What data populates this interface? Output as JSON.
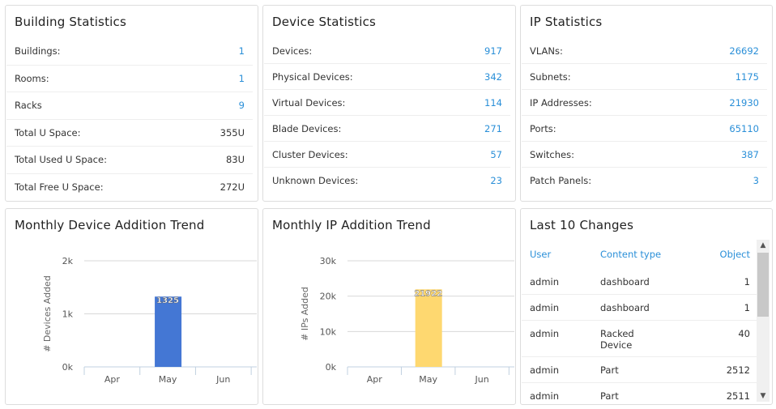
{
  "building": {
    "title": "Building Statistics",
    "rows": [
      {
        "label": "Buildings:",
        "value": "1",
        "link": true
      },
      {
        "label": "Rooms:",
        "value": "1",
        "link": true
      },
      {
        "label": "Racks",
        "value": "9",
        "link": true
      },
      {
        "label": "Total U Space:",
        "value": "355U",
        "link": false
      },
      {
        "label": "Total Used U Space:",
        "value": "83U",
        "link": false
      },
      {
        "label": "Total Free U Space:",
        "value": "272U",
        "link": false
      }
    ]
  },
  "device": {
    "title": "Device Statistics",
    "rows": [
      {
        "label": "Devices:",
        "value": "917",
        "link": true
      },
      {
        "label": "Physical Devices:",
        "value": "342",
        "link": true
      },
      {
        "label": "Virtual Devices:",
        "value": "114",
        "link": true
      },
      {
        "label": "Blade Devices:",
        "value": "271",
        "link": true
      },
      {
        "label": "Cluster Devices:",
        "value": "57",
        "link": true
      },
      {
        "label": "Unknown Devices:",
        "value": "23",
        "link": true
      }
    ]
  },
  "ip": {
    "title": "IP Statistics",
    "rows": [
      {
        "label": "VLANs:",
        "value": "26692",
        "link": true
      },
      {
        "label": "Subnets:",
        "value": "1175",
        "link": true
      },
      {
        "label": "IP Addresses:",
        "value": "21930",
        "link": true
      },
      {
        "label": "Ports:",
        "value": "65110",
        "link": true
      },
      {
        "label": "Switches:",
        "value": "387",
        "link": true
      },
      {
        "label": "Patch Panels:",
        "value": "3",
        "link": true
      }
    ]
  },
  "chart_data": [
    {
      "type": "bar",
      "title": "Monthly Device Addition Trend",
      "ylabel": "# Devices Added",
      "xlabel": "",
      "categories": [
        "Apr",
        "May",
        "Jun"
      ],
      "values": [
        0,
        1325,
        0
      ],
      "data_labels": [
        "",
        "1325",
        ""
      ],
      "ylim": [
        0,
        2000
      ],
      "yticks": [
        "0k",
        "1k",
        "2k"
      ],
      "color": "#4477d4",
      "grid": true
    },
    {
      "type": "bar",
      "title": "Monthly IP Addition Trend",
      "ylabel": "# IPs Added",
      "xlabel": "",
      "categories": [
        "Apr",
        "May",
        "Jun"
      ],
      "values": [
        0,
        21922,
        0
      ],
      "data_labels": [
        "",
        "21922",
        ""
      ],
      "ylim": [
        0,
        30000
      ],
      "yticks": [
        "0k",
        "10k",
        "20k",
        "30k"
      ],
      "color": "#fed870",
      "grid": true
    }
  ],
  "changes": {
    "title": "Last 10 Changes",
    "headers": [
      "User",
      "Content type",
      "Object"
    ],
    "rows": [
      [
        "admin",
        "dashboard",
        "1"
      ],
      [
        "admin",
        "dashboard",
        "1"
      ],
      [
        "admin",
        "Racked Device",
        "40"
      ],
      [
        "admin",
        "Part",
        "2512"
      ],
      [
        "admin",
        "Part",
        "2511"
      ]
    ]
  }
}
